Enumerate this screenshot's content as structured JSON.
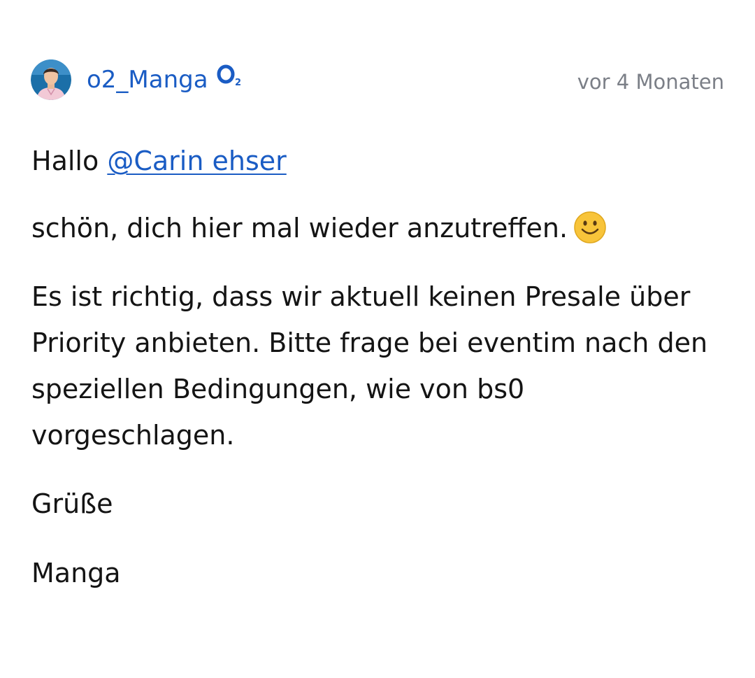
{
  "post": {
    "author": {
      "username": "o2_Manga",
      "badge_icon": "o2-logo-icon",
      "avatar_icon": "avatar-icon"
    },
    "timestamp": "vor 4 Monaten",
    "body": {
      "greeting_prefix": "Hallo",
      "mention": "@Carin ehser",
      "nice_to_see": "schön, dich hier mal wieder anzutreffen.",
      "emoji_icon": "smiley-emoji-icon",
      "main_text": "Es ist richtig, dass wir aktuell keinen Presale über Priority anbieten. Bitte frage bei eventim nach den speziellen Bedingungen, wie von bs0 vorgeschlagen.",
      "regards": "Grüße",
      "signature": "Manga"
    },
    "colors": {
      "link": "#1a5cc4",
      "text": "#141414",
      "muted": "#7b7f87"
    }
  }
}
